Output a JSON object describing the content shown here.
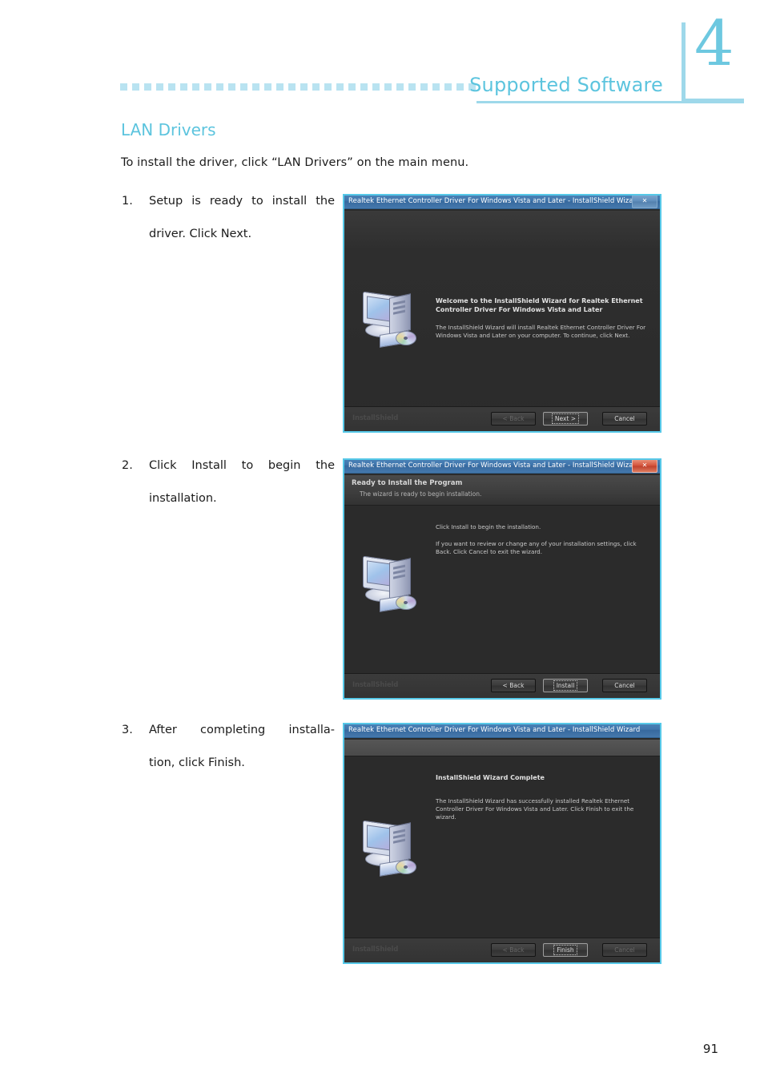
{
  "chapter": {
    "number": "4"
  },
  "header": {
    "title": "Supported Software",
    "dot_count": 30
  },
  "section": {
    "title": "LAN Drivers",
    "intro": "To install the driver, click “LAN Drivers” on the main menu."
  },
  "steps": [
    {
      "num": "1.",
      "line1": "Setup is ready to install the",
      "line2": "driver. Click Next."
    },
    {
      "num": "2.",
      "line1": "Click Install to begin the",
      "line2": "installation."
    },
    {
      "num": "3.",
      "line1": "After completing installa-",
      "line2": "tion, click Finish."
    }
  ],
  "dialogs": [
    {
      "title": "Realtek Ethernet Controller Driver For Windows Vista and Later - InstallShield Wizard",
      "close_label": "✕",
      "heading": "Welcome to the InstallShield Wizard for Realtek Ethernet Controller Driver For Windows Vista and Later",
      "paragraph": "The InstallShield Wizard will install Realtek Ethernet Controller Driver For Windows Vista and Later on your computer.  To continue, click Next.",
      "watermark": "InstallShield",
      "buttons": {
        "back": "< Back",
        "mid": "Next >",
        "cancel": "Cancel"
      }
    },
    {
      "title": "Realtek Ethernet Controller Driver For Windows Vista and Later - InstallShield Wizard",
      "close_label": "✕",
      "banner_heading": "Ready to Install the Program",
      "banner_sub": "The wizard is ready to begin installation.",
      "paragraph1": "Click Install to begin the installation.",
      "paragraph2": "If you want to review or change any of your installation settings, click Back. Click Cancel to exit the wizard.",
      "watermark": "InstallShield",
      "buttons": {
        "back": "< Back",
        "mid": "Install",
        "cancel": "Cancel"
      }
    },
    {
      "title": "Realtek Ethernet Controller Driver For Windows Vista and Later - InstallShield Wizard",
      "heading": "InstallShield Wizard Complete",
      "paragraph": "The InstallShield Wizard has successfully installed Realtek Ethernet Controller Driver For Windows Vista and Later.  Click Finish to exit the wizard.",
      "watermark": "InstallShield",
      "buttons": {
        "back": "< Back",
        "mid": "Finish",
        "cancel": "Cancel"
      }
    }
  ],
  "footer": {
    "page_number": "91"
  },
  "colors": {
    "accent": "#5cc4de",
    "accent_light": "#b9e3f1",
    "rule": "#9ed8ea",
    "dialog_border": "#3a8fd0",
    "dialog_border_glow": "#56c8e8"
  }
}
